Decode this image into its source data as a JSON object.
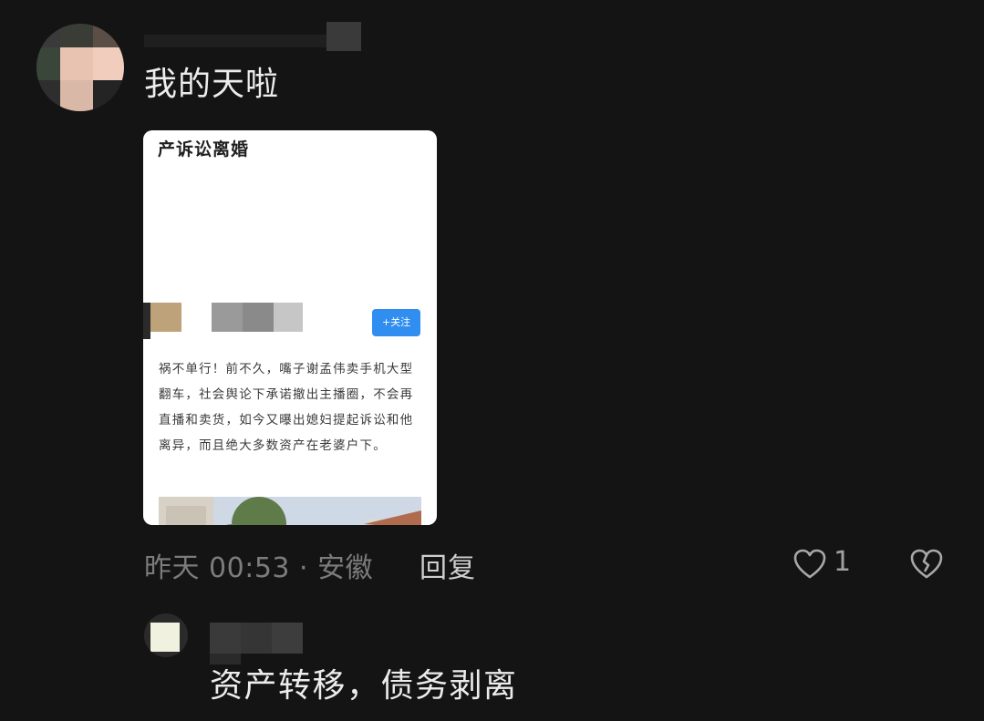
{
  "comment": {
    "text": "我的天啦",
    "time_location": "昨天 00:53 · 安徽",
    "reply_label": "回复",
    "like_count": "1"
  },
  "card": {
    "title": "产诉讼离婚",
    "follow_label": "+关注",
    "body": "祸不单行！前不久，嘴子谢孟伟卖手机大型翻车，社会舆论下承诺撤出主播圈，不会再直播和卖货，如今又曝出媳妇提起诉讼和他离异，而且绝大多数资产在老婆户下。"
  },
  "reply": {
    "text": "资产转移，债务剥离"
  },
  "icons": {
    "like": "heart-outline-icon",
    "dislike": "broken-heart-icon"
  },
  "colors": {
    "background": "#141414",
    "follow_button": "#2f8ef0",
    "muted_text": "#7c7c7c"
  }
}
